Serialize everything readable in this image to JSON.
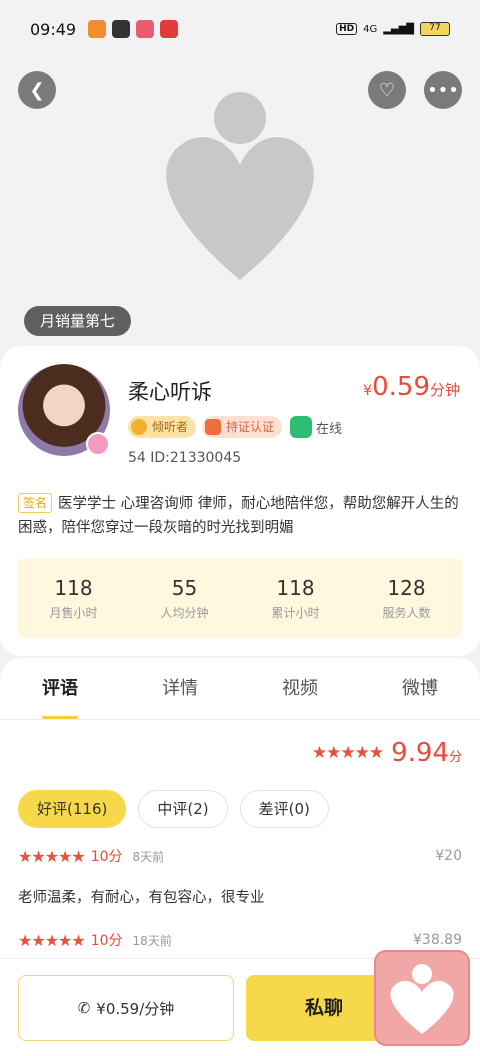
{
  "status_bar": {
    "time": "09:49",
    "indicators": "HD",
    "signal": "4G",
    "battery": "77"
  },
  "hero": {
    "rank_badge": "月销量第七"
  },
  "profile": {
    "name": "柔心听诉",
    "price_symbol": "¥",
    "price": "0.59",
    "price_unit": "分钟",
    "tag_listener": "倾听者",
    "tag_cert": "持证认证",
    "online_status": "在线",
    "id_line": "54  ID:21330045",
    "signature_label": "签名",
    "bio": "医学学士 心理咨询师 律师，耐心地陪伴您，帮助您解开人生的困惑，陪伴您穿过一段灰暗的时光找到明媚",
    "stats": [
      {
        "value": "118",
        "label": "月售小时"
      },
      {
        "value": "55",
        "label": "人均分钟"
      },
      {
        "value": "118",
        "label": "累计小时"
      },
      {
        "value": "128",
        "label": "服务人数"
      }
    ]
  },
  "tabs": [
    "评语",
    "详情",
    "视频",
    "微博"
  ],
  "rating": {
    "stars": "★★★★★",
    "score": "9.94",
    "unit": "分"
  },
  "filters": [
    "好评(116)",
    "中评(2)",
    "差评(0)"
  ],
  "reviews": [
    {
      "stars": "★★★★★",
      "points": "10分",
      "time": "8天前",
      "amount": "¥20",
      "text": "老师温柔，有耐心，有包容心，很专业"
    },
    {
      "stars": "★★★★★",
      "points": "10分",
      "time": "18天前",
      "amount": "¥38.89",
      "text": ""
    }
  ],
  "bottom": {
    "call_label": "¥0.59/分钟",
    "chat_label": "私聊"
  },
  "colors": {
    "accent": "#f6d84a",
    "price": "#e84b3a"
  }
}
